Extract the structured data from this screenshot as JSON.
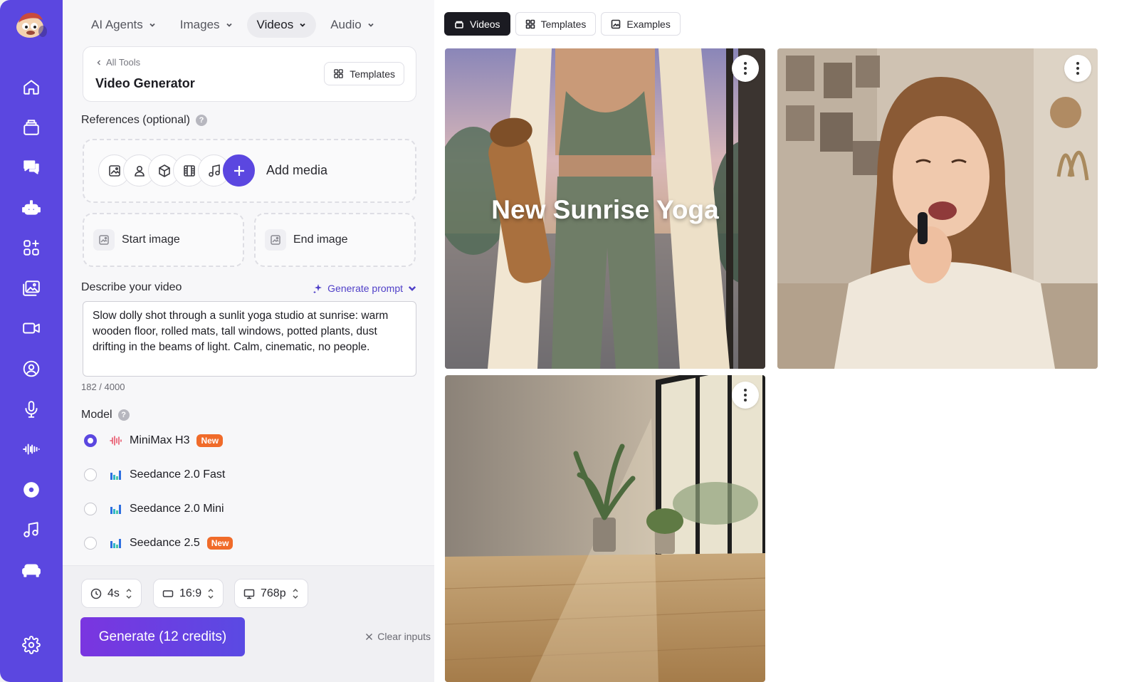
{
  "topnav": [
    {
      "label": "AI Agents"
    },
    {
      "label": "Images"
    },
    {
      "label": "Videos"
    },
    {
      "label": "Audio"
    }
  ],
  "tool": {
    "breadcrumb": "All Tools",
    "title": "Video Generator",
    "templates_label": "Templates"
  },
  "references": {
    "label": "References (optional)",
    "add_media": "Add media",
    "start_image": "Start image",
    "end_image": "End image"
  },
  "describe": {
    "label": "Describe your video",
    "generate_prompt": "Generate prompt",
    "text": "Slow dolly shot through a sunlit yoga studio at sunrise: warm wooden floor, rolled mats, tall windows, potted plants, dust drifting in the beams of light. Calm, cinematic, no people.",
    "count": "182 / 4000"
  },
  "model": {
    "label": "Model",
    "options": [
      {
        "name": "MiniMax H3",
        "badge": "New",
        "selected": true
      },
      {
        "name": "Seedance 2.0 Fast",
        "badge": "",
        "selected": false
      },
      {
        "name": "Seedance 2.0 Mini",
        "badge": "",
        "selected": false
      },
      {
        "name": "Seedance 2.5",
        "badge": "New",
        "selected": false
      }
    ]
  },
  "settings": {
    "duration": "4s",
    "aspect": "16:9",
    "resolution": "768p"
  },
  "actions": {
    "generate": "Generate (12 credits)",
    "clear": "Clear inputs"
  },
  "gallery": {
    "tabs": [
      {
        "label": "Videos"
      },
      {
        "label": "Templates"
      },
      {
        "label": "Examples"
      }
    ],
    "cards": [
      {
        "overlay": "New Sunrise Yoga"
      },
      {
        "overlay": ""
      },
      {
        "overlay": ""
      }
    ]
  },
  "colors": {
    "accent": "#5b47e0",
    "badge": "#f06b2a"
  }
}
